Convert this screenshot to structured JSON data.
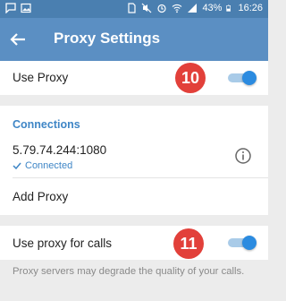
{
  "statusbar": {
    "battery_percent": "43%",
    "time": "16:26"
  },
  "appbar": {
    "title": "Proxy Settings"
  },
  "use_proxy": {
    "label": "Use Proxy",
    "badge": "10",
    "enabled": true
  },
  "connections": {
    "section_title": "Connections",
    "items": [
      {
        "address": "5.79.74.244:1080",
        "status": "Connected"
      }
    ],
    "add_label": "Add Proxy"
  },
  "calls": {
    "label": "Use proxy for calls",
    "badge": "11",
    "enabled": true
  },
  "footer": {
    "note": "Proxy servers may degrade the quality of your calls."
  },
  "colors": {
    "appbar": "#5b8fc3",
    "statusbar": "#4a7fb0",
    "accent": "#3f86c6",
    "badge": "#e2403a"
  }
}
